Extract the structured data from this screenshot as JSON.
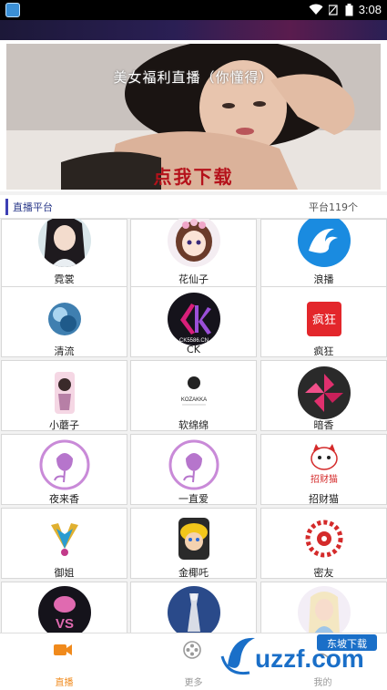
{
  "status_bar": {
    "time": "3:08"
  },
  "banner": {
    "title": "美女福利直播（你懂得）",
    "cta": "点我下载"
  },
  "section": {
    "title": "直播平台",
    "count": "平台119个"
  },
  "platforms": [
    {
      "label": "霓裳",
      "icon": "anime-girl-avatar"
    },
    {
      "label": "花仙子",
      "icon": "flower-fairy-avatar"
    },
    {
      "label": "浪播",
      "icon": "wave-logo"
    },
    {
      "label": "清流",
      "icon": "blue-orb-logo"
    },
    {
      "label": "CK",
      "icon": "ck-logo"
    },
    {
      "label": "疯狂",
      "icon": "crazy-logo"
    },
    {
      "label": "小蘑子",
      "icon": "girl-illustration"
    },
    {
      "label": "软绵绵",
      "icon": "kozakka-logo"
    },
    {
      "label": "暗香",
      "icon": "pinwheel-logo"
    },
    {
      "label": "夜来香",
      "icon": "rose-logo"
    },
    {
      "label": "一直爱",
      "icon": "rose-logo"
    },
    {
      "label": "招财猫",
      "icon": "lucky-cat-logo"
    },
    {
      "label": "御姐",
      "icon": "peacock-logo"
    },
    {
      "label": "金椰吒",
      "icon": "cartoon-face-logo"
    },
    {
      "label": "密友",
      "icon": "ornament-logo"
    },
    {
      "label": "",
      "icon": "vs-logo"
    },
    {
      "label": "",
      "icon": "statue-logo"
    },
    {
      "label": "",
      "icon": "princess-logo"
    }
  ],
  "ck_logo_text": "CK5586.CN",
  "kozakka_text": "KOZAKKA",
  "crazy_text": "疯狂",
  "lucky_cat_text": "招财猫",
  "vs_text": "VS",
  "nav": [
    {
      "label": "直播",
      "icon": "video-camera-icon",
      "active": true
    },
    {
      "label": "更多",
      "icon": "film-reel-icon",
      "active": false
    },
    {
      "label": "我的",
      "icon": "user-icon",
      "active": false
    }
  ],
  "watermark": {
    "text": "uzzf.com",
    "badge": "东坡下载"
  },
  "colors": {
    "accent": "#f08a1c",
    "section_bar": "#3d3fb4",
    "cta": "#b5121b"
  }
}
